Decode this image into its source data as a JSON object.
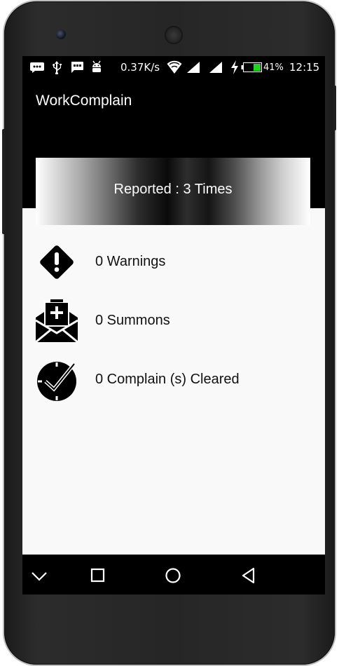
{
  "status_bar": {
    "network_speed": "0.37K/s",
    "battery_percent": "41%",
    "time": "12:15",
    "battery_level": 0.41,
    "icons": [
      "chat-bubble-icon",
      "usb-icon",
      "sms-icon",
      "android-icon",
      "wifi-icon",
      "signal-icon",
      "signal-icon",
      "charging-icon",
      "battery-icon"
    ]
  },
  "app_bar": {
    "title": "WorkComplain"
  },
  "banner": {
    "text": "Reported : 3 Times"
  },
  "stats": [
    {
      "icon": "warning-diamond-icon",
      "label": "0 Warnings"
    },
    {
      "icon": "summons-envelope-icon",
      "label": "0 Summons"
    },
    {
      "icon": "cleared-check-icon",
      "label": "0 Complain (s) Cleared"
    }
  ],
  "nav_bar": {
    "buttons": [
      "hide-keyboard-icon",
      "recents-icon",
      "home-icon",
      "back-icon"
    ]
  },
  "colors": {
    "background": "#000000",
    "content_background": "#f9f9f9",
    "battery_fill": "#22d422",
    "text_on_dark": "#ffffff",
    "text_on_light": "#111111"
  }
}
